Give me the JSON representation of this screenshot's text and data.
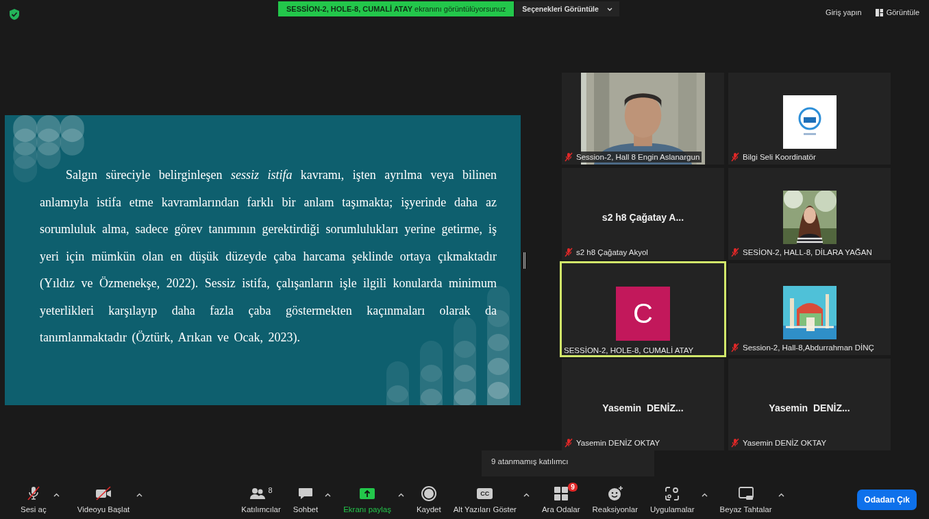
{
  "top_bar": {
    "banner": "**SESSİON-2, HOLE-8, CUMALİ ATAY** ekranını görüntülüyorsunuz",
    "view_options": "Seçenekleri Görüntüle",
    "sign_in": "Giriş yapın",
    "view": "Görüntüle"
  },
  "slide": {
    "paragraph": "Salgın süreciyle belirginleşen *sessiz istifa* kavramı, işten ayrılma veya bilinen anlamıyla istifa etme kavramlarından farklı bir anlam taşımakta; işyerinde daha az sorumluluk alma, sadece görev tanımının gerektirdiği sorumlulukları yerine getirme, iş yeri için mümkün olan en düşük düzeyde çaba harcama şeklinde ortaya çıkmaktadır (Yıldız ve Özmenekşe, 2022). Sessiz istifa, çalışanların işle ilgili konularda minimum yeterlikleri karşılayıp daha fazla çaba göstermekten kaçınmaları olarak da tanımlanmaktadır (Öztürk, Arıkan ve Ocak, 2023)."
  },
  "participants": [
    {
      "kind": "video",
      "name": "Session-2, Hall 8 Engin Aslanargun",
      "muted": true,
      "active_speaker": false
    },
    {
      "kind": "logo",
      "name": "Bilgi Seli Koordinatör",
      "muted": true,
      "active_speaker": false
    },
    {
      "kind": "name",
      "display_name": "s2 h8 Çağatay A...",
      "name": "s2 h8 Çağatay Akyol",
      "muted": true,
      "active_speaker": false
    },
    {
      "name": "SESİON-2, HALL-8, DİLARA YAĞAN",
      "muted": true,
      "active_speaker": false
    },
    {
      "kind": "initial",
      "initial": "C",
      "name": "SESSİON-2, HOLE-8, CUMALİ ATAY",
      "muted": false,
      "active_speaker": true
    },
    {
      "kind": "painting",
      "name": "Session-2, Hall-8,Abdurrahman DİNÇ",
      "muted": true,
      "active_speaker": false
    },
    {
      "kind": "name",
      "display_name": "Yasemin  DENİZ...",
      "name": "Yasemin DENİZ OKTAY",
      "muted": true,
      "active_speaker": false
    },
    {
      "kind": "name",
      "display_name": "Yasemin  DENİZ...",
      "name": "Yasemin DENİZ OKTAY",
      "muted": true,
      "active_speaker": false
    }
  ],
  "tooltip": "9 atanmamış katılımcı",
  "toolbar": {
    "left": [
      {
        "kind": "mic",
        "label": "Sesi aç",
        "caret": true,
        "active": false
      },
      {
        "kind": "video",
        "label": "Videoyu Başlat",
        "caret": true,
        "active": false
      }
    ],
    "center": [
      {
        "kind": "participants",
        "label": "Katılımcılar",
        "count": "8",
        "caret": false,
        "active": false
      },
      {
        "kind": "chat",
        "label": "Sohbet",
        "caret": true,
        "active": false
      },
      {
        "kind": "share",
        "label": "Ekranı paylaş",
        "caret": true,
        "active": true
      },
      {
        "kind": "record",
        "label": "Kaydet",
        "caret": false,
        "active": false
      },
      {
        "kind": "captions",
        "label": "Alt Yazıları Göster",
        "icon_text": "CC",
        "caret": true,
        "active": false
      },
      {
        "kind": "breakout",
        "label": "Ara Odalar",
        "badge": "9",
        "caret": false,
        "active": false
      },
      {
        "kind": "reactions",
        "label": "Reaksiyonlar",
        "caret": false,
        "active": false
      },
      {
        "kind": "apps",
        "label": "Uygulamalar",
        "caret": true,
        "active": false
      },
      {
        "kind": "whiteboard",
        "label": "Beyaz Tahtalar",
        "caret": true,
        "active": false
      }
    ],
    "leave": "Odadan Çık"
  }
}
